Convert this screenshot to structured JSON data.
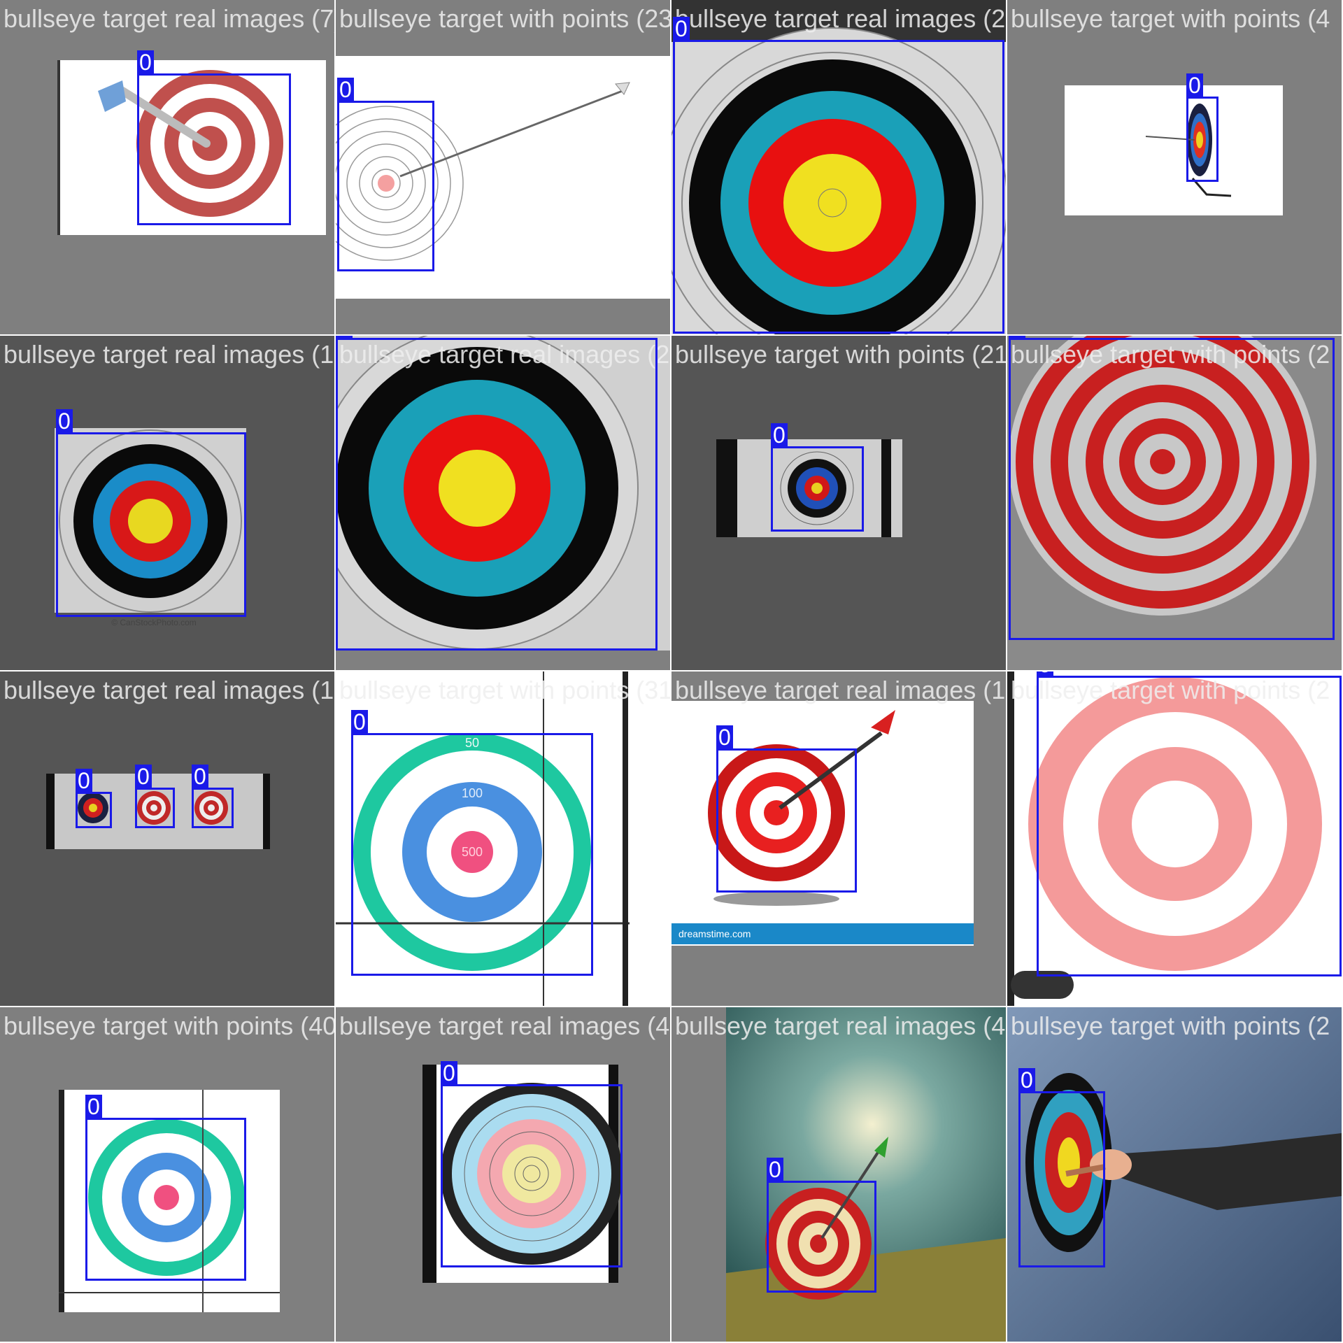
{
  "class_label": "0",
  "box_color": "#1a1ae8",
  "tiles": [
    {
      "filename": "bullseye target real images (7).jpg",
      "detections": 1
    },
    {
      "filename": "bullseye target with points (230).jpeg",
      "detections": 1
    },
    {
      "filename": "bullseye target real images (27).jpeg",
      "detections": 1
    },
    {
      "filename": "bullseye target with points (4",
      "detections": 1
    },
    {
      "filename": "bullseye target real images (107).jpg",
      "detections": 1
    },
    {
      "filename": "bullseye target real images (27).jpeg",
      "detections": 1
    },
    {
      "filename": "bullseye target with points (213).jpeg",
      "detections": 1
    },
    {
      "filename": "bullseye target with points (2",
      "detections": 1
    },
    {
      "filename": "bullseye target real images (104).jpg",
      "detections": 3
    },
    {
      "filename": "bullseye target with points (312).jpeg",
      "detections": 1
    },
    {
      "filename": "bullseye target real images (10).jpeg",
      "detections": 1
    },
    {
      "filename": "bullseye target with points (2",
      "detections": 1
    },
    {
      "filename": "bullseye target with points (403).jpeg",
      "detections": 1
    },
    {
      "filename": "bullseye target real images (44).jpeg",
      "detections": 1
    },
    {
      "filename": "bullseye target real images (47).jpeg",
      "detections": 1
    },
    {
      "filename": "bullseye target with points (2",
      "detections": 1
    }
  ],
  "tile_texts": {
    "t7_watermark": "© CanStockPhoto.com",
    "t10_ring_50": "50",
    "t10_ring_100": "100",
    "t10_ring_500": "500",
    "t11_footer": "dreamstime.com"
  }
}
